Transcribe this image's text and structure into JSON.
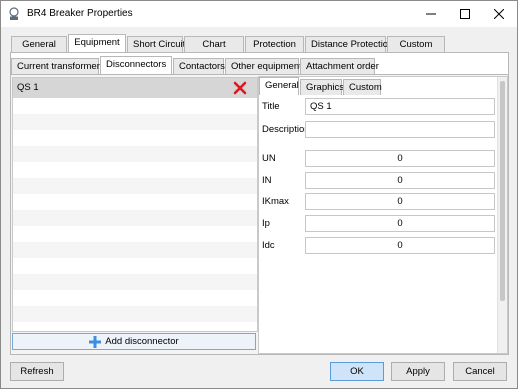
{
  "window": {
    "title": "BR4 Breaker Properties",
    "controls": [
      "minimize-icon",
      "maximize-icon",
      "close-icon"
    ]
  },
  "tabs_top": [
    "General",
    "Equipment",
    "Short Circuit",
    "Chart",
    "Protection",
    "Distance Protection",
    "Custom"
  ],
  "tabs_top_active": "Equipment",
  "tabs_equipment": [
    "Current transformers",
    "Disconnectors",
    "Contactors",
    "Other equipment",
    "Attachment order"
  ],
  "tabs_equipment_active": "Disconnectors",
  "disconnector_list": {
    "items": [
      "QS 1"
    ],
    "selected": "QS 1",
    "add_label": "Add disconnector"
  },
  "detail_tabs": [
    "General",
    "Graphics",
    "Custom"
  ],
  "detail_tabs_active": "General",
  "fields": {
    "title_label": "Title",
    "title_value": "QS 1",
    "description_label": "Description",
    "description_value": "",
    "un_label": "UN",
    "un_value": "0",
    "in_label": "IN",
    "in_value": "0",
    "ikmax_label": "IKmax",
    "ikmax_value": "0",
    "ip_label": "Ip",
    "ip_value": "0",
    "idc_label": "Idc",
    "idc_value": "0"
  },
  "buttons": {
    "refresh": "Refresh",
    "ok": "OK",
    "apply": "Apply",
    "cancel": "Cancel"
  },
  "colors": {
    "delete": "#e0161e",
    "add": "#3d8fe0",
    "primary_button": "#cfe4f8"
  }
}
